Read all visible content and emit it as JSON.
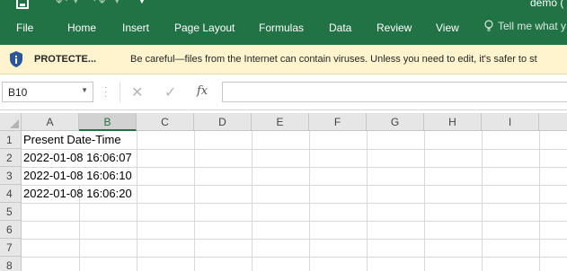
{
  "title_bar": {
    "doc_title": "demo ("
  },
  "ribbon": {
    "tabs": [
      "File",
      "Home",
      "Insert",
      "Page Layout",
      "Formulas",
      "Data",
      "Review",
      "View"
    ],
    "tell_me": "Tell me what y"
  },
  "protected_view": {
    "title": "PROTECTE...",
    "message": "Be careful—files from the Internet can contain viruses. Unless you need to edit, it's safer to st"
  },
  "formula_bar": {
    "name_box": "B10",
    "formula": ""
  },
  "sheet": {
    "columns": [
      "A",
      "B",
      "C",
      "D",
      "E",
      "F",
      "G",
      "H",
      "I"
    ],
    "selected_column": "B",
    "rows": [
      "1",
      "2",
      "3",
      "4",
      "5",
      "6",
      "7",
      "8"
    ],
    "cells": {
      "A1": "Present Date-Time",
      "A2": "2022-01-08 16:06:07",
      "A3": "2022-01-08 16:06:10",
      "A4": "2022-01-08 16:06:20"
    }
  },
  "colors": {
    "accent": "#217346",
    "warning_bar": "#fff4ce",
    "shield": "#2b579a"
  }
}
